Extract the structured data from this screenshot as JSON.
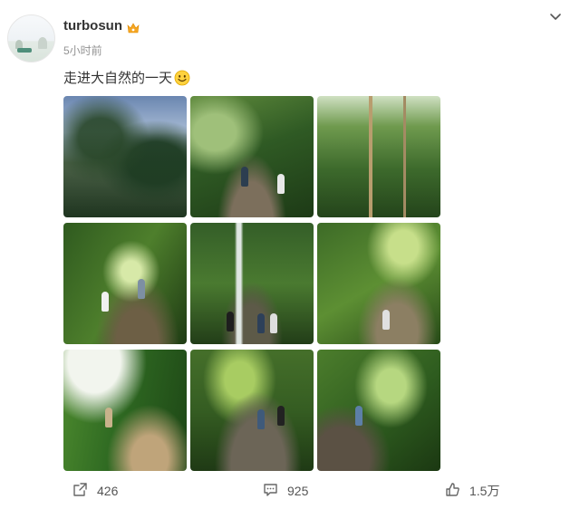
{
  "post": {
    "username": "turbosun",
    "time": "5小时前",
    "text": "走进大自然的一天"
  },
  "icons": {
    "avatar": "avatar-image",
    "badge": "crown-icon",
    "menu": "chevron-down-icon",
    "emoji": "smile-emoji-icon",
    "share": "share-icon",
    "comment": "comment-icon",
    "like": "thumbs-up-icon"
  },
  "photos": [
    "photo-1",
    "photo-2",
    "photo-3",
    "photo-4",
    "photo-5",
    "photo-6",
    "photo-7",
    "photo-8",
    "photo-9"
  ],
  "actions": {
    "share_count": "426",
    "comment_count": "925",
    "like_count": "1.5万"
  },
  "colors": {
    "badge": "#f5a623",
    "text": "#333333",
    "muted": "#939393"
  }
}
